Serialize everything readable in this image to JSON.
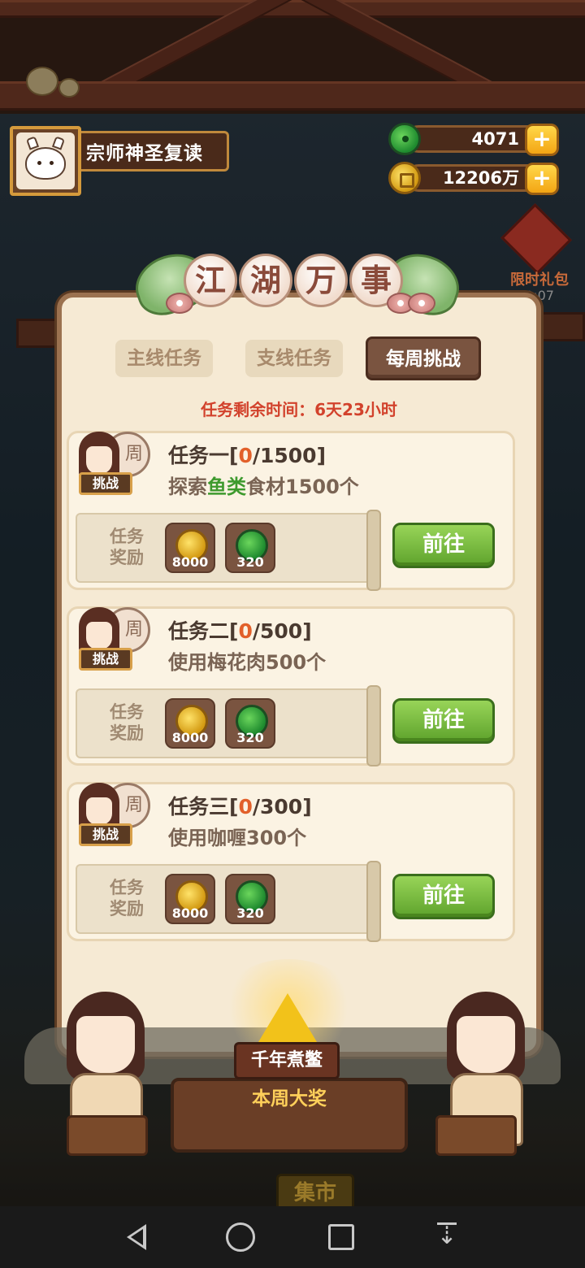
{
  "header": {
    "username": "宗师神圣复读",
    "currencies": [
      {
        "type": "jade",
        "value": "4071",
        "icon": "jade-icon"
      },
      {
        "type": "coin",
        "value": "12206万",
        "icon": "coin-icon"
      }
    ],
    "plus_label": "+"
  },
  "promo": {
    "label": "限时礼包",
    "timer": "9:07"
  },
  "panel": {
    "title_chars": [
      "江",
      "湖",
      "万",
      "事"
    ],
    "tabs": [
      {
        "label": "主线任务",
        "active": false
      },
      {
        "label": "支线任务",
        "active": false
      },
      {
        "label": "每周挑战",
        "active": true
      }
    ],
    "remaining_time": "任务剩余时间：6天23小时"
  },
  "tasks": [
    {
      "portrait_disc": "周",
      "badge": "挑战",
      "name": "任务一",
      "progress_current": "0",
      "progress_total": "/1500",
      "desc_prefix": "探索",
      "desc_highlight": "鱼类",
      "desc_suffix": "食材1500个",
      "reward_label": "任务奖励",
      "rewards": [
        {
          "type": "coin",
          "amount": "8000"
        },
        {
          "type": "jade",
          "amount": "320"
        }
      ],
      "button": "前往"
    },
    {
      "portrait_disc": "周",
      "badge": "挑战",
      "name": "任务二",
      "progress_current": "0",
      "progress_total": "/500",
      "desc_prefix": "使用梅花肉500个",
      "desc_highlight": "",
      "desc_suffix": "",
      "reward_label": "任务奖励",
      "rewards": [
        {
          "type": "coin",
          "amount": "8000"
        },
        {
          "type": "jade",
          "amount": "320"
        }
      ],
      "button": "前往"
    },
    {
      "portrait_disc": "周",
      "badge": "挑战",
      "name": "任务三",
      "progress_current": "0",
      "progress_total": "/300",
      "desc_prefix": "使用咖喱300个",
      "desc_highlight": "",
      "desc_suffix": "",
      "reward_label": "任务奖励",
      "rewards": [
        {
          "type": "coin",
          "amount": "8000"
        },
        {
          "type": "jade",
          "amount": "320"
        }
      ],
      "button": "前往"
    }
  ],
  "prize": {
    "name": "千年煮鳖",
    "subtitle": "本周大奖"
  },
  "background": {
    "market_sign": "集市"
  },
  "navbar": {
    "icons": [
      "back-icon",
      "home-icon",
      "recent-apps-icon",
      "collapse-icon"
    ]
  }
}
